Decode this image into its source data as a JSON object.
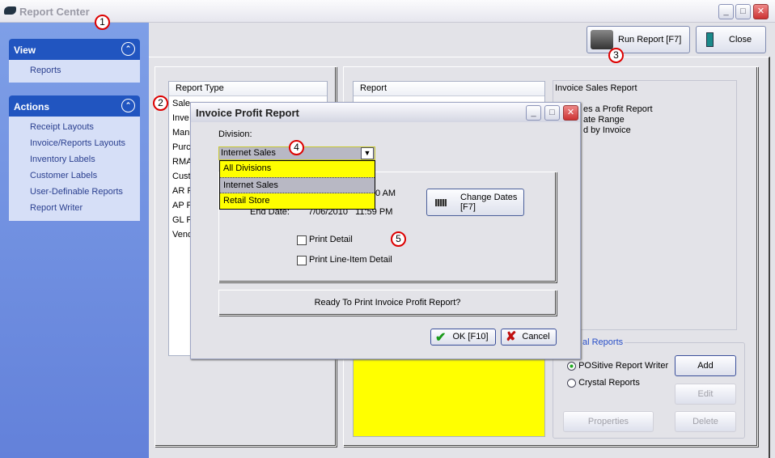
{
  "window": {
    "title": "Report Center"
  },
  "sidebar": {
    "view": {
      "title": "View",
      "items": [
        "Reports"
      ]
    },
    "actions": {
      "title": "Actions",
      "items": [
        "Receipt Layouts",
        "Invoice/Reports Layouts",
        "Inventory Labels",
        "Customer Labels",
        "User-Definable Reports",
        "Report Writer"
      ]
    }
  },
  "toolbar": {
    "run_report": "Run Report [F7]",
    "close": "Close"
  },
  "report_type": {
    "header": "Report Type",
    "items": [
      "Sale",
      "Inve",
      "Man",
      "Purc",
      "RMA",
      "Cust",
      "AR F",
      "AP F",
      "GL F",
      "Vend"
    ]
  },
  "report_list": {
    "header": "Report",
    "highlight_color": "#ffff00"
  },
  "description": {
    "title": "Invoice Sales Report",
    "lines": [
      "es a Profit Report",
      "ate Range",
      "d by Invoice"
    ]
  },
  "report_engine": {
    "legend": "al Reports",
    "options": [
      {
        "label": "POSitive Report Writer",
        "selected": true
      },
      {
        "label": "Crystal Reports",
        "selected": false
      }
    ],
    "add": "Add",
    "edit": "Edit",
    "delete": "Delete",
    "properties": "Properties"
  },
  "dialog": {
    "title": "Invoice Profit Report",
    "division_label": "Division:",
    "division_value": "Internet Sales",
    "division_options": [
      "All Divisions",
      "Internet Sales",
      "Retail Store"
    ],
    "start_fragment": "0 AM",
    "end_label": "End Date:",
    "end_value": "7/06/2010   11:59 PM",
    "change_dates": "Change Dates",
    "change_dates_key": "[F7]",
    "print_detail": "Print Detail",
    "print_line_item": "Print Line-Item Detail",
    "ready": "Ready To Print Invoice Profit Report?",
    "ok": "OK [F10]",
    "cancel": "Cancel"
  },
  "annotations": [
    "1",
    "2",
    "3",
    "4",
    "5"
  ]
}
